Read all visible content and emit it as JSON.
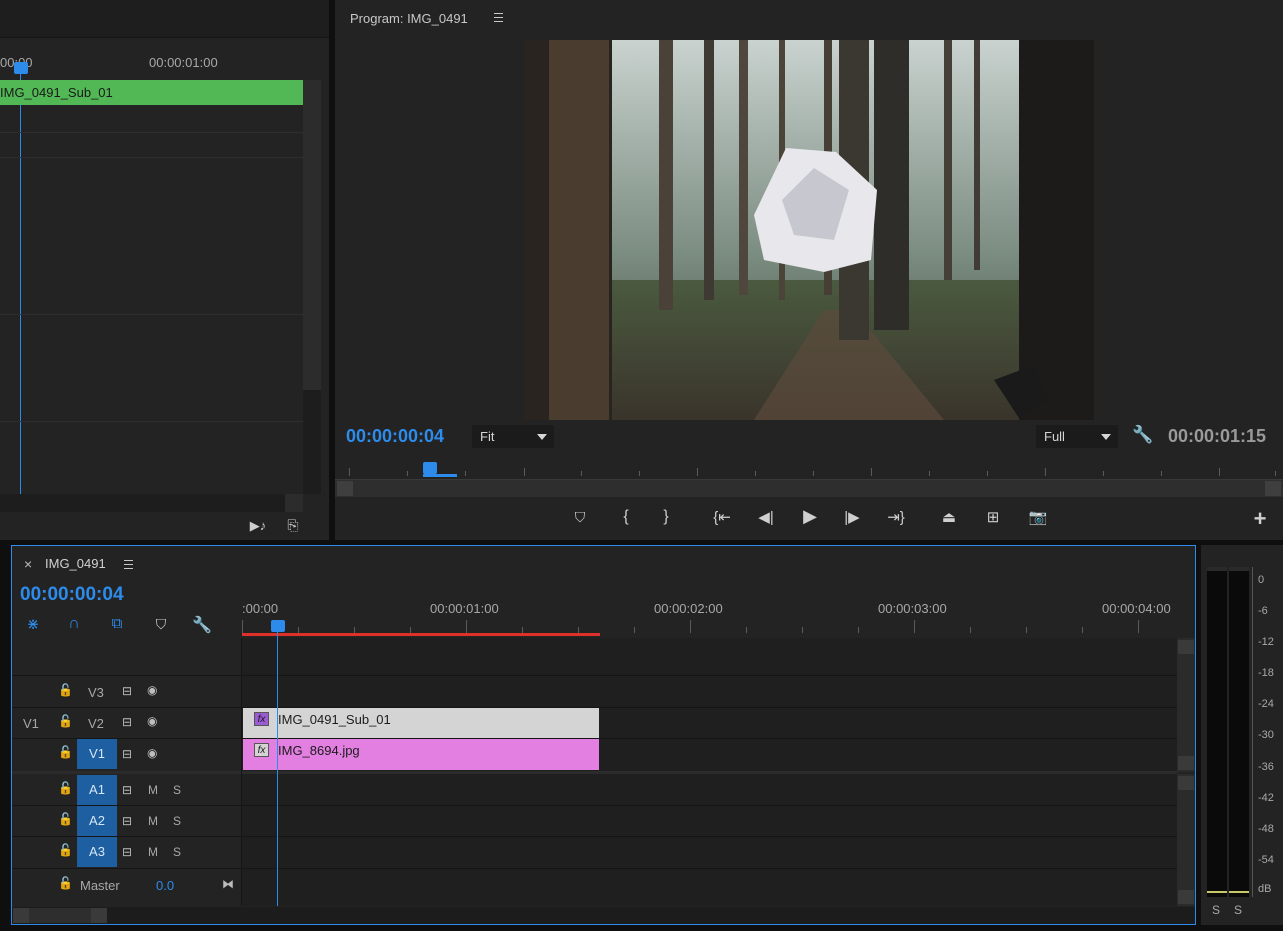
{
  "source_monitor": {
    "ruler_start": "00:00",
    "ruler_mid": "00:00:01:00",
    "clip_label": "IMG_0491_Sub_01"
  },
  "program_monitor": {
    "title": "Program: IMG_0491",
    "menu_icon": "hamburger-icon",
    "timecode_current": "00:00:00:04",
    "fit_select": "Fit",
    "quality_select": "Full",
    "timecode_duration": "00:00:01:15",
    "colors": {
      "timecode": "#2d8ceb",
      "bg": "#232323"
    }
  },
  "transport": {
    "buttons": [
      "add-marker",
      "mark-in",
      "mark-out",
      "go-to-in",
      "step-back",
      "play",
      "step-forward",
      "go-to-out",
      "lift",
      "extract",
      "export-frame",
      "add-button"
    ]
  },
  "timeline": {
    "close": "×",
    "sequence_name": "IMG_0491",
    "timecode": "00:00:00:04",
    "ruler_labels": [
      ":00:00",
      "00:00:01:00",
      "00:00:02:00",
      "00:00:03:00",
      "00:00:04:00"
    ],
    "tracks": {
      "v3": {
        "label": "V3"
      },
      "v2": {
        "label": "V2",
        "source": "V1"
      },
      "v1": {
        "label": "V1"
      },
      "a1": {
        "label": "A1",
        "m": "M",
        "s": "S"
      },
      "a2": {
        "label": "A2",
        "m": "M",
        "s": "S"
      },
      "a3": {
        "label": "A3",
        "m": "M",
        "s": "S"
      },
      "master": {
        "label": "Master",
        "value": "0.0"
      }
    },
    "clips": {
      "v2": {
        "name": "IMG_0491_Sub_01",
        "color": "#d4d4d4"
      },
      "v1": {
        "name": "IMG_8694.jpg",
        "color": "#e27fe0"
      }
    },
    "fx": "fx",
    "colors": {
      "work_area": "#e0302a",
      "target": "#1d5fa0",
      "playhead": "#2d8ceb"
    }
  },
  "audio_meter": {
    "scale": [
      "0",
      "-6",
      "-12",
      "-18",
      "-24",
      "-30",
      "-36",
      "-42",
      "-48",
      "-54",
      "dB"
    ],
    "solo_left": "S",
    "solo_right": "S"
  }
}
